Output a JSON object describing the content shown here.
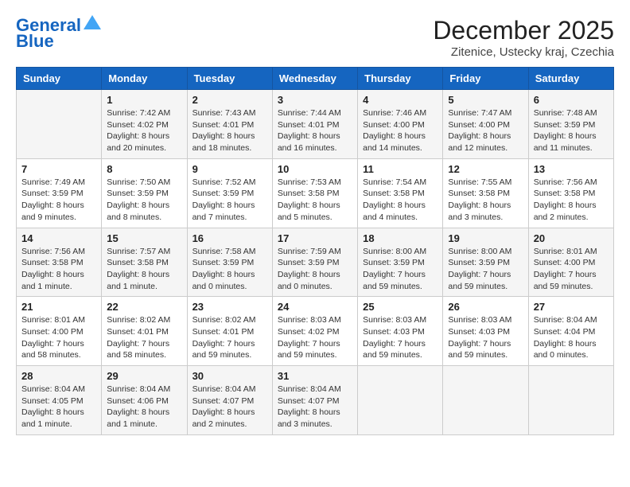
{
  "header": {
    "logo_line1": "General",
    "logo_line2": "Blue",
    "month_title": "December 2025",
    "location": "Zitenice, Ustecky kraj, Czechia"
  },
  "days_of_week": [
    "Sunday",
    "Monday",
    "Tuesday",
    "Wednesday",
    "Thursday",
    "Friday",
    "Saturday"
  ],
  "weeks": [
    [
      {
        "day": "",
        "info": ""
      },
      {
        "day": "1",
        "info": "Sunrise: 7:42 AM\nSunset: 4:02 PM\nDaylight: 8 hours\nand 20 minutes."
      },
      {
        "day": "2",
        "info": "Sunrise: 7:43 AM\nSunset: 4:01 PM\nDaylight: 8 hours\nand 18 minutes."
      },
      {
        "day": "3",
        "info": "Sunrise: 7:44 AM\nSunset: 4:01 PM\nDaylight: 8 hours\nand 16 minutes."
      },
      {
        "day": "4",
        "info": "Sunrise: 7:46 AM\nSunset: 4:00 PM\nDaylight: 8 hours\nand 14 minutes."
      },
      {
        "day": "5",
        "info": "Sunrise: 7:47 AM\nSunset: 4:00 PM\nDaylight: 8 hours\nand 12 minutes."
      },
      {
        "day": "6",
        "info": "Sunrise: 7:48 AM\nSunset: 3:59 PM\nDaylight: 8 hours\nand 11 minutes."
      }
    ],
    [
      {
        "day": "7",
        "info": "Sunrise: 7:49 AM\nSunset: 3:59 PM\nDaylight: 8 hours\nand 9 minutes."
      },
      {
        "day": "8",
        "info": "Sunrise: 7:50 AM\nSunset: 3:59 PM\nDaylight: 8 hours\nand 8 minutes."
      },
      {
        "day": "9",
        "info": "Sunrise: 7:52 AM\nSunset: 3:59 PM\nDaylight: 8 hours\nand 7 minutes."
      },
      {
        "day": "10",
        "info": "Sunrise: 7:53 AM\nSunset: 3:58 PM\nDaylight: 8 hours\nand 5 minutes."
      },
      {
        "day": "11",
        "info": "Sunrise: 7:54 AM\nSunset: 3:58 PM\nDaylight: 8 hours\nand 4 minutes."
      },
      {
        "day": "12",
        "info": "Sunrise: 7:55 AM\nSunset: 3:58 PM\nDaylight: 8 hours\nand 3 minutes."
      },
      {
        "day": "13",
        "info": "Sunrise: 7:56 AM\nSunset: 3:58 PM\nDaylight: 8 hours\nand 2 minutes."
      }
    ],
    [
      {
        "day": "14",
        "info": "Sunrise: 7:56 AM\nSunset: 3:58 PM\nDaylight: 8 hours\nand 1 minute."
      },
      {
        "day": "15",
        "info": "Sunrise: 7:57 AM\nSunset: 3:58 PM\nDaylight: 8 hours\nand 1 minute."
      },
      {
        "day": "16",
        "info": "Sunrise: 7:58 AM\nSunset: 3:59 PM\nDaylight: 8 hours\nand 0 minutes."
      },
      {
        "day": "17",
        "info": "Sunrise: 7:59 AM\nSunset: 3:59 PM\nDaylight: 8 hours\nand 0 minutes."
      },
      {
        "day": "18",
        "info": "Sunrise: 8:00 AM\nSunset: 3:59 PM\nDaylight: 7 hours\nand 59 minutes."
      },
      {
        "day": "19",
        "info": "Sunrise: 8:00 AM\nSunset: 3:59 PM\nDaylight: 7 hours\nand 59 minutes."
      },
      {
        "day": "20",
        "info": "Sunrise: 8:01 AM\nSunset: 4:00 PM\nDaylight: 7 hours\nand 59 minutes."
      }
    ],
    [
      {
        "day": "21",
        "info": "Sunrise: 8:01 AM\nSunset: 4:00 PM\nDaylight: 7 hours\nand 58 minutes."
      },
      {
        "day": "22",
        "info": "Sunrise: 8:02 AM\nSunset: 4:01 PM\nDaylight: 7 hours\nand 58 minutes."
      },
      {
        "day": "23",
        "info": "Sunrise: 8:02 AM\nSunset: 4:01 PM\nDaylight: 7 hours\nand 59 minutes."
      },
      {
        "day": "24",
        "info": "Sunrise: 8:03 AM\nSunset: 4:02 PM\nDaylight: 7 hours\nand 59 minutes."
      },
      {
        "day": "25",
        "info": "Sunrise: 8:03 AM\nSunset: 4:03 PM\nDaylight: 7 hours\nand 59 minutes."
      },
      {
        "day": "26",
        "info": "Sunrise: 8:03 AM\nSunset: 4:03 PM\nDaylight: 7 hours\nand 59 minutes."
      },
      {
        "day": "27",
        "info": "Sunrise: 8:04 AM\nSunset: 4:04 PM\nDaylight: 8 hours\nand 0 minutes."
      }
    ],
    [
      {
        "day": "28",
        "info": "Sunrise: 8:04 AM\nSunset: 4:05 PM\nDaylight: 8 hours\nand 1 minute."
      },
      {
        "day": "29",
        "info": "Sunrise: 8:04 AM\nSunset: 4:06 PM\nDaylight: 8 hours\nand 1 minute."
      },
      {
        "day": "30",
        "info": "Sunrise: 8:04 AM\nSunset: 4:07 PM\nDaylight: 8 hours\nand 2 minutes."
      },
      {
        "day": "31",
        "info": "Sunrise: 8:04 AM\nSunset: 4:07 PM\nDaylight: 8 hours\nand 3 minutes."
      },
      {
        "day": "",
        "info": ""
      },
      {
        "day": "",
        "info": ""
      },
      {
        "day": "",
        "info": ""
      }
    ]
  ]
}
